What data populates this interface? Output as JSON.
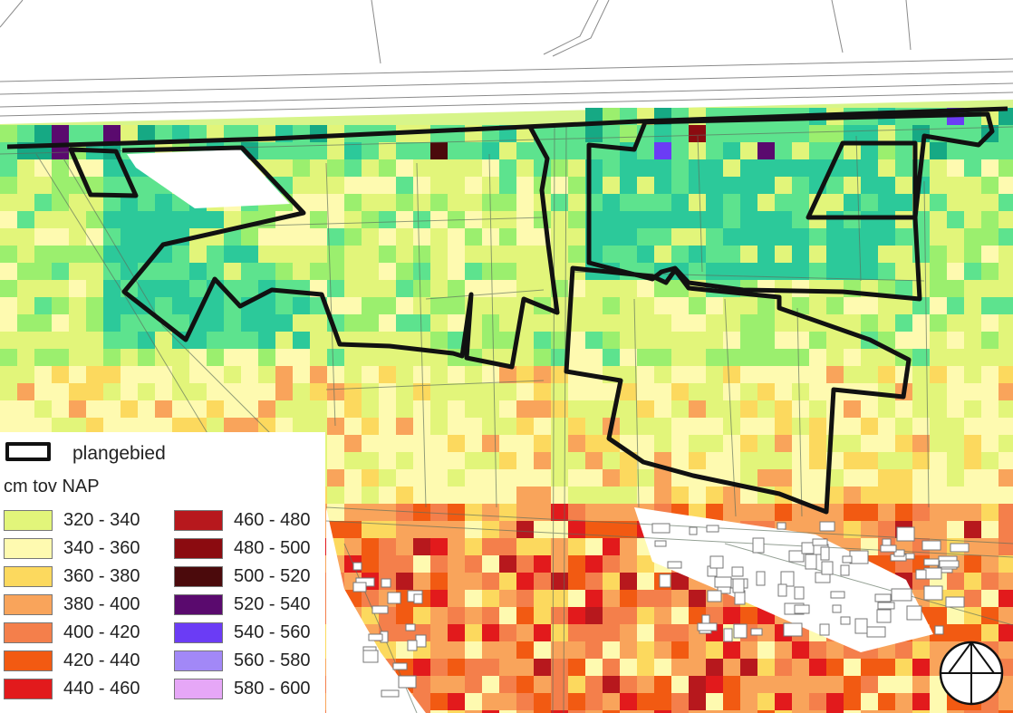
{
  "map": {
    "layers": [
      "parcel lines",
      "road (top)",
      "elevation raster",
      "plangebied boundary",
      "settlement buildings (bottom right)"
    ],
    "palette_background": "#d7f58a"
  },
  "legend": {
    "boundary_label": "plangebied",
    "unit_label": "cm tov NAP",
    "classes": [
      {
        "label": "320 - 340",
        "color": "#e2f57a"
      },
      {
        "label": "340 - 360",
        "color": "#fefab0"
      },
      {
        "label": "360 - 380",
        "color": "#fcd95e"
      },
      {
        "label": "380 - 400",
        "color": "#f9a45b"
      },
      {
        "label": "400 - 420",
        "color": "#f47f4b"
      },
      {
        "label": "420 - 440",
        "color": "#f25a12"
      },
      {
        "label": "440 - 460",
        "color": "#e21a1c"
      },
      {
        "label": "460 - 480",
        "color": "#b7181d"
      },
      {
        "label": "480 - 500",
        "color": "#8b0b10"
      },
      {
        "label": "500 - 520",
        "color": "#4b0a0c"
      },
      {
        "label": "520 - 540",
        "color": "#5a0a6e"
      },
      {
        "label": "540 - 560",
        "color": "#6b3cf5"
      },
      {
        "label": "560 - 580",
        "color": "#a288f7"
      },
      {
        "label": "580 - 600",
        "color": "#e6a7f7"
      }
    ],
    "extra_colors": {
      "green_1": "#9bef6e",
      "green_2": "#5de38e",
      "green_3": "#2cc99a",
      "green_4": "#16a984"
    }
  },
  "north_arrow": {
    "icon": "north-arrow-icon"
  }
}
